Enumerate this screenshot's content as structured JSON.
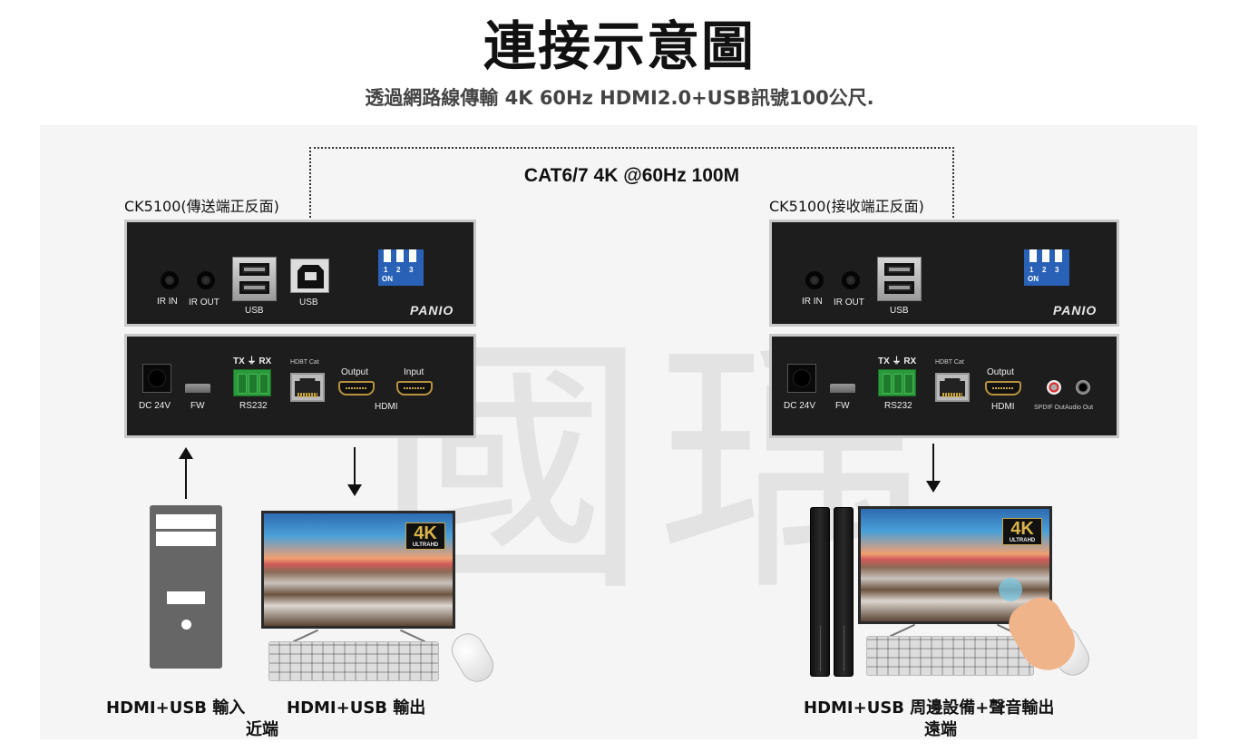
{
  "header": {
    "title": "連接示意圖",
    "subtitle": "透過網路線傳輸 4K 60Hz HDMI2.0+USB訊號100公尺."
  },
  "watermark": "國瑀",
  "cable": {
    "label": "CAT6/7 4K @60Hz 100M"
  },
  "transmitter": {
    "label": "CK5100(傳送端正反面)",
    "front": {
      "ir_in": "IR IN",
      "ir_out": "IR OUT",
      "usb_a": "USB",
      "usb_b": "USB",
      "dip": [
        "1",
        "2",
        "3"
      ],
      "dip_on": "ON",
      "brand": "PANIO"
    },
    "rear": {
      "dc": "DC 24V",
      "fw": "FW",
      "rs232_top": "TX ⏚ RX",
      "rs232": "RS232",
      "hdbt": "HDBT Cat",
      "hdmi_output": "Output",
      "hdmi_input": "Input",
      "hdmi": "HDMI"
    }
  },
  "receiver": {
    "label": "CK5100(接收端正反面)",
    "front": {
      "ir_in": "IR IN",
      "ir_out": "IR OUT",
      "usb_a": "USB",
      "dip": [
        "1",
        "2",
        "3"
      ],
      "dip_on": "ON",
      "brand": "PANIO"
    },
    "rear": {
      "dc": "DC 24V",
      "fw": "FW",
      "rs232_top": "TX ⏚ RX",
      "rs232": "RS232",
      "hdbt": "HDBT Cat",
      "hdmi_output": "Output",
      "hdmi": "HDMI",
      "spdif": "SPDIF Out",
      "audio": "Audio Out"
    }
  },
  "devices": {
    "badge_main": "4K",
    "badge_sub": "ULTRAHD"
  },
  "captions": {
    "near_input": "HDMI+USB 輸入",
    "near_output": "HDMI+USB 輸出",
    "near_label": "近端",
    "far_output": "HDMI+USB 周邊設備+聲音輸出",
    "far_label": "遠端"
  }
}
